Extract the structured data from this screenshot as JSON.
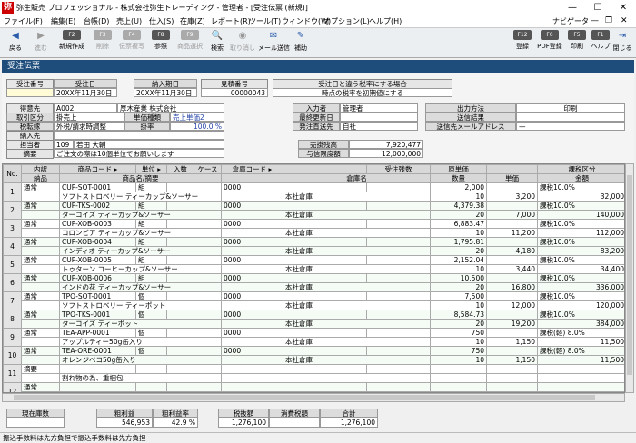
{
  "window": {
    "title": "弥生販売 プロフェッショナル - 株式会社弥生トレーディング - 管理者 - [受注伝票 (新規)]",
    "minimize": "—",
    "maximize": "☐",
    "close": "✕"
  },
  "menu": {
    "items": [
      "ファイル(F)",
      "編集(E)",
      "台帳(D)",
      "売上(U)",
      "仕入(S)",
      "在庫(Z)",
      "レポート(R)",
      "ツール(T)",
      "ウィンドウ(W)",
      "オプション(L)",
      "ヘルプ(H)"
    ],
    "navigator": "ナビゲータ",
    "mdi_min": "—",
    "mdi_restore": "❐",
    "mdi_close": "✕"
  },
  "toolbar": {
    "left": [
      {
        "icon": "◀",
        "key": "",
        "label": "戻る",
        "disabled": false
      },
      {
        "icon": "▶",
        "key": "",
        "label": "進む",
        "disabled": true
      },
      {
        "icon": "",
        "key": "F2",
        "label": "新規作成",
        "disabled": false
      },
      {
        "icon": "",
        "key": "F3",
        "label": "削除",
        "disabled": true
      },
      {
        "icon": "",
        "key": "F4",
        "label": "伝票複写",
        "disabled": true
      },
      {
        "icon": "",
        "key": "F8",
        "label": "参照",
        "disabled": false
      },
      {
        "icon": "",
        "key": "F9",
        "label": "商品選択",
        "disabled": true
      },
      {
        "icon": "🔍",
        "key": "",
        "label": "検索",
        "disabled": false
      },
      {
        "icon": "◉",
        "key": "",
        "label": "取り消し",
        "disabled": true
      },
      {
        "icon": "✉",
        "key": "",
        "label": "メール送信",
        "disabled": false
      },
      {
        "icon": "✎",
        "key": "",
        "label": "補助",
        "disabled": false
      }
    ],
    "right": [
      {
        "key": "F12",
        "label": "登録"
      },
      {
        "key": "F6",
        "label": "PDF登録"
      },
      {
        "key": "F5",
        "label": "印刷"
      },
      {
        "key": "F1",
        "label": "ヘルプ"
      },
      {
        "key": "",
        "label": "閉じる"
      }
    ]
  },
  "header": {
    "title": "受注伝票"
  },
  "form": {
    "order_no_label": "受注番号",
    "order_date_label": "受注日",
    "delivery_date_label": "納入期日",
    "estimate_no_label": "見積番号",
    "tax_rate_button": "受注日と違う税率にする場合",
    "order_date": "20XX年11月30日",
    "delivery_date": "20XX年11月30日",
    "estimate_no": "00000043",
    "tax_rate_note": "時点の税率を初期値にする",
    "customer_label": "得意先",
    "customer_code": "A002",
    "customer_name": "厚木産業 株式会社",
    "entry_user_label": "入力者",
    "entry_user": "管理者",
    "trade_type_label": "取引区分",
    "trade_type": "掛売上",
    "price_type_label": "単価種類",
    "price_type": "売上単価2",
    "last_update_label": "最終更新日",
    "output_method_label": "出力方法",
    "output_method": "印刷",
    "tax_method_label": "税転嫁",
    "tax_method": "外税/請求時調整",
    "rate_label": "掛率",
    "rate": "100.0 %",
    "ship_label": "発注直送先",
    "ship_value": "自社",
    "send_result_label": "送信結果",
    "delivery_label": "納入先",
    "send_mail_label": "送信先メールアドレス",
    "send_mail": "—",
    "staff_label": "担当者",
    "staff_code": "109",
    "staff_name": "若田 大輔",
    "balance_label": "売掛残高",
    "balance": "7,920,477",
    "memo_label": "摘要",
    "memo": "ご注文の際は10個単位でお願いします",
    "credit_label": "与信限度額",
    "credit": "12,000,000"
  },
  "grid": {
    "head1": [
      "No.",
      "内訳",
      "商品コード ▸",
      "単位 ▸",
      "入数",
      "ケース",
      "倉庫コード ▸",
      "",
      "受注残数",
      "原単価",
      "",
      "課税区分"
    ],
    "head2": [
      "",
      "納品",
      "商品名/摘要",
      "",
      "",
      "",
      "倉庫名",
      "",
      "数量",
      "単価",
      "金額",
      "備考"
    ],
    "rows": [
      {
        "no": "1",
        "kind": "通常",
        "code": "CUP-SOT-0001",
        "unit": "組",
        "wh_code": "0000",
        "name": "ソフトストロベリー ティーカップ&ソーサー",
        "wh_name": "本社倉庫",
        "qty": "10",
        "cost": "2,000",
        "price": "3,200",
        "amount": "32,000",
        "tax": "課税10.0%"
      },
      {
        "no": "2",
        "kind": "通常",
        "code": "CUP-TKS-0002",
        "unit": "組",
        "wh_code": "0000",
        "name": "ターコイズ ティーカップ&ソーサー",
        "wh_name": "本社倉庫",
        "qty": "20",
        "cost": "4,379.38",
        "price": "7,000",
        "amount": "140,000",
        "tax": "課税10.0%"
      },
      {
        "no": "3",
        "kind": "通常",
        "code": "CUP-XOB-0003",
        "unit": "組",
        "wh_code": "0000",
        "name": "コロンビア ティーカップ&ソーサー",
        "wh_name": "本社倉庫",
        "qty": "10",
        "cost": "6,883.47",
        "price": "11,200",
        "amount": "112,000",
        "tax": "課税10.0%"
      },
      {
        "no": "4",
        "kind": "通常",
        "code": "CUP-XOB-0004",
        "unit": "組",
        "wh_code": "0000",
        "name": "インディオ ティーカップ&ソーサー",
        "wh_name": "本社倉庫",
        "qty": "20",
        "cost": "1,795.81",
        "price": "4,180",
        "amount": "83,200",
        "tax": "課税10.0%"
      },
      {
        "no": "5",
        "kind": "通常",
        "code": "CUP-XOB-0005",
        "unit": "組",
        "wh_code": "0000",
        "name": "トゥターン コーヒーカップ&ソーサー",
        "wh_name": "本社倉庫",
        "qty": "10",
        "cost": "2,152.04",
        "price": "3,440",
        "amount": "34,400",
        "tax": "課税10.0%"
      },
      {
        "no": "6",
        "kind": "通常",
        "code": "CUP-XOB-0006",
        "unit": "組",
        "wh_code": "0000",
        "name": "インドの花 ティーカップ&ソーサー",
        "wh_name": "本社倉庫",
        "qty": "20",
        "cost": "10,500",
        "price": "16,800",
        "amount": "336,000",
        "tax": "課税10.0%"
      },
      {
        "no": "7",
        "kind": "通常",
        "code": "TPO-SOT-0001",
        "unit": "個",
        "wh_code": "0000",
        "name": "ソフトストロベリー ティーポット",
        "wh_name": "本社倉庫",
        "qty": "10",
        "cost": "7,500",
        "price": "12,000",
        "amount": "120,000",
        "tax": "課税10.0%"
      },
      {
        "no": "8",
        "kind": "通常",
        "code": "TPO-TKS-0001",
        "unit": "個",
        "wh_code": "0000",
        "name": "ターコイズ ティーポット",
        "wh_name": "本社倉庫",
        "qty": "20",
        "cost": "8,584.73",
        "price": "19,200",
        "amount": "384,000",
        "tax": "課税10.0%"
      },
      {
        "no": "9",
        "kind": "通常",
        "code": "TEA-APP-0001",
        "unit": "個",
        "wh_code": "0000",
        "name": "アップルティー50g缶入り",
        "wh_name": "本社倉庫",
        "qty": "10",
        "cost": "750",
        "price": "1,150",
        "amount": "11,500",
        "tax": "課税(軽) 8.0%"
      },
      {
        "no": "10",
        "kind": "通常",
        "code": "TEA-ORE-0001",
        "unit": "個",
        "wh_code": "0000",
        "name": "オレンジペコ50g缶入り",
        "wh_name": "本社倉庫",
        "qty": "10",
        "cost": "750",
        "price": "1,150",
        "amount": "11,500",
        "tax": "課税(軽) 8.0%"
      },
      {
        "no": "11",
        "kind": "摘要",
        "code": "",
        "unit": "",
        "wh_code": "",
        "name": "割れ物の為、重梱包",
        "wh_name": "",
        "qty": "",
        "cost": "",
        "price": "",
        "amount": "",
        "tax": ""
      },
      {
        "no": "12",
        "kind": "通常",
        "code": "",
        "unit": "",
        "wh_code": "",
        "name": "",
        "wh_name": "",
        "qty": "",
        "cost": "",
        "price": "",
        "amount": "",
        "tax": ""
      }
    ]
  },
  "totals": {
    "stock_label": "現在庫数",
    "profit_label": "粗利益",
    "profit": "546,953",
    "profit_rate_label": "粗利益率",
    "profit_rate": "42.9 %",
    "pretax_label": "税抜額",
    "pretax": "1,276,100",
    "tax_label": "消費税額",
    "tax": "",
    "total_label": "合計",
    "total": "1,276,100"
  },
  "status": {
    "text": "振込手数料は先方負担で振込手数料は先方負担"
  }
}
